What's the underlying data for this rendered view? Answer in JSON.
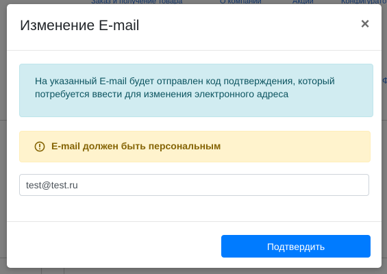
{
  "background": {
    "nav_items": [
      "Заказ и получение товара",
      "О компании",
      "Акции",
      "Конфигуратор"
    ],
    "side_letter": "Ф"
  },
  "modal": {
    "title": "Изменение E-mail",
    "close_glyph": "×",
    "info_text": "На указанный E-mail будет отправлен код подтверждения, который потребуется ввести для изменения электронного адреса",
    "warning_text": "E-mail должен быть персональным",
    "email_value": "test@test.ru",
    "confirm_label": "Подтвердить"
  },
  "colors": {
    "primary": "#007bff",
    "info_bg": "#d1ecf1",
    "info_text": "#0c5460",
    "warning_bg": "#fff3cd",
    "warning_text": "#856404"
  },
  "icons": {
    "warning": "exclamation-circle-icon",
    "close": "close-icon"
  }
}
